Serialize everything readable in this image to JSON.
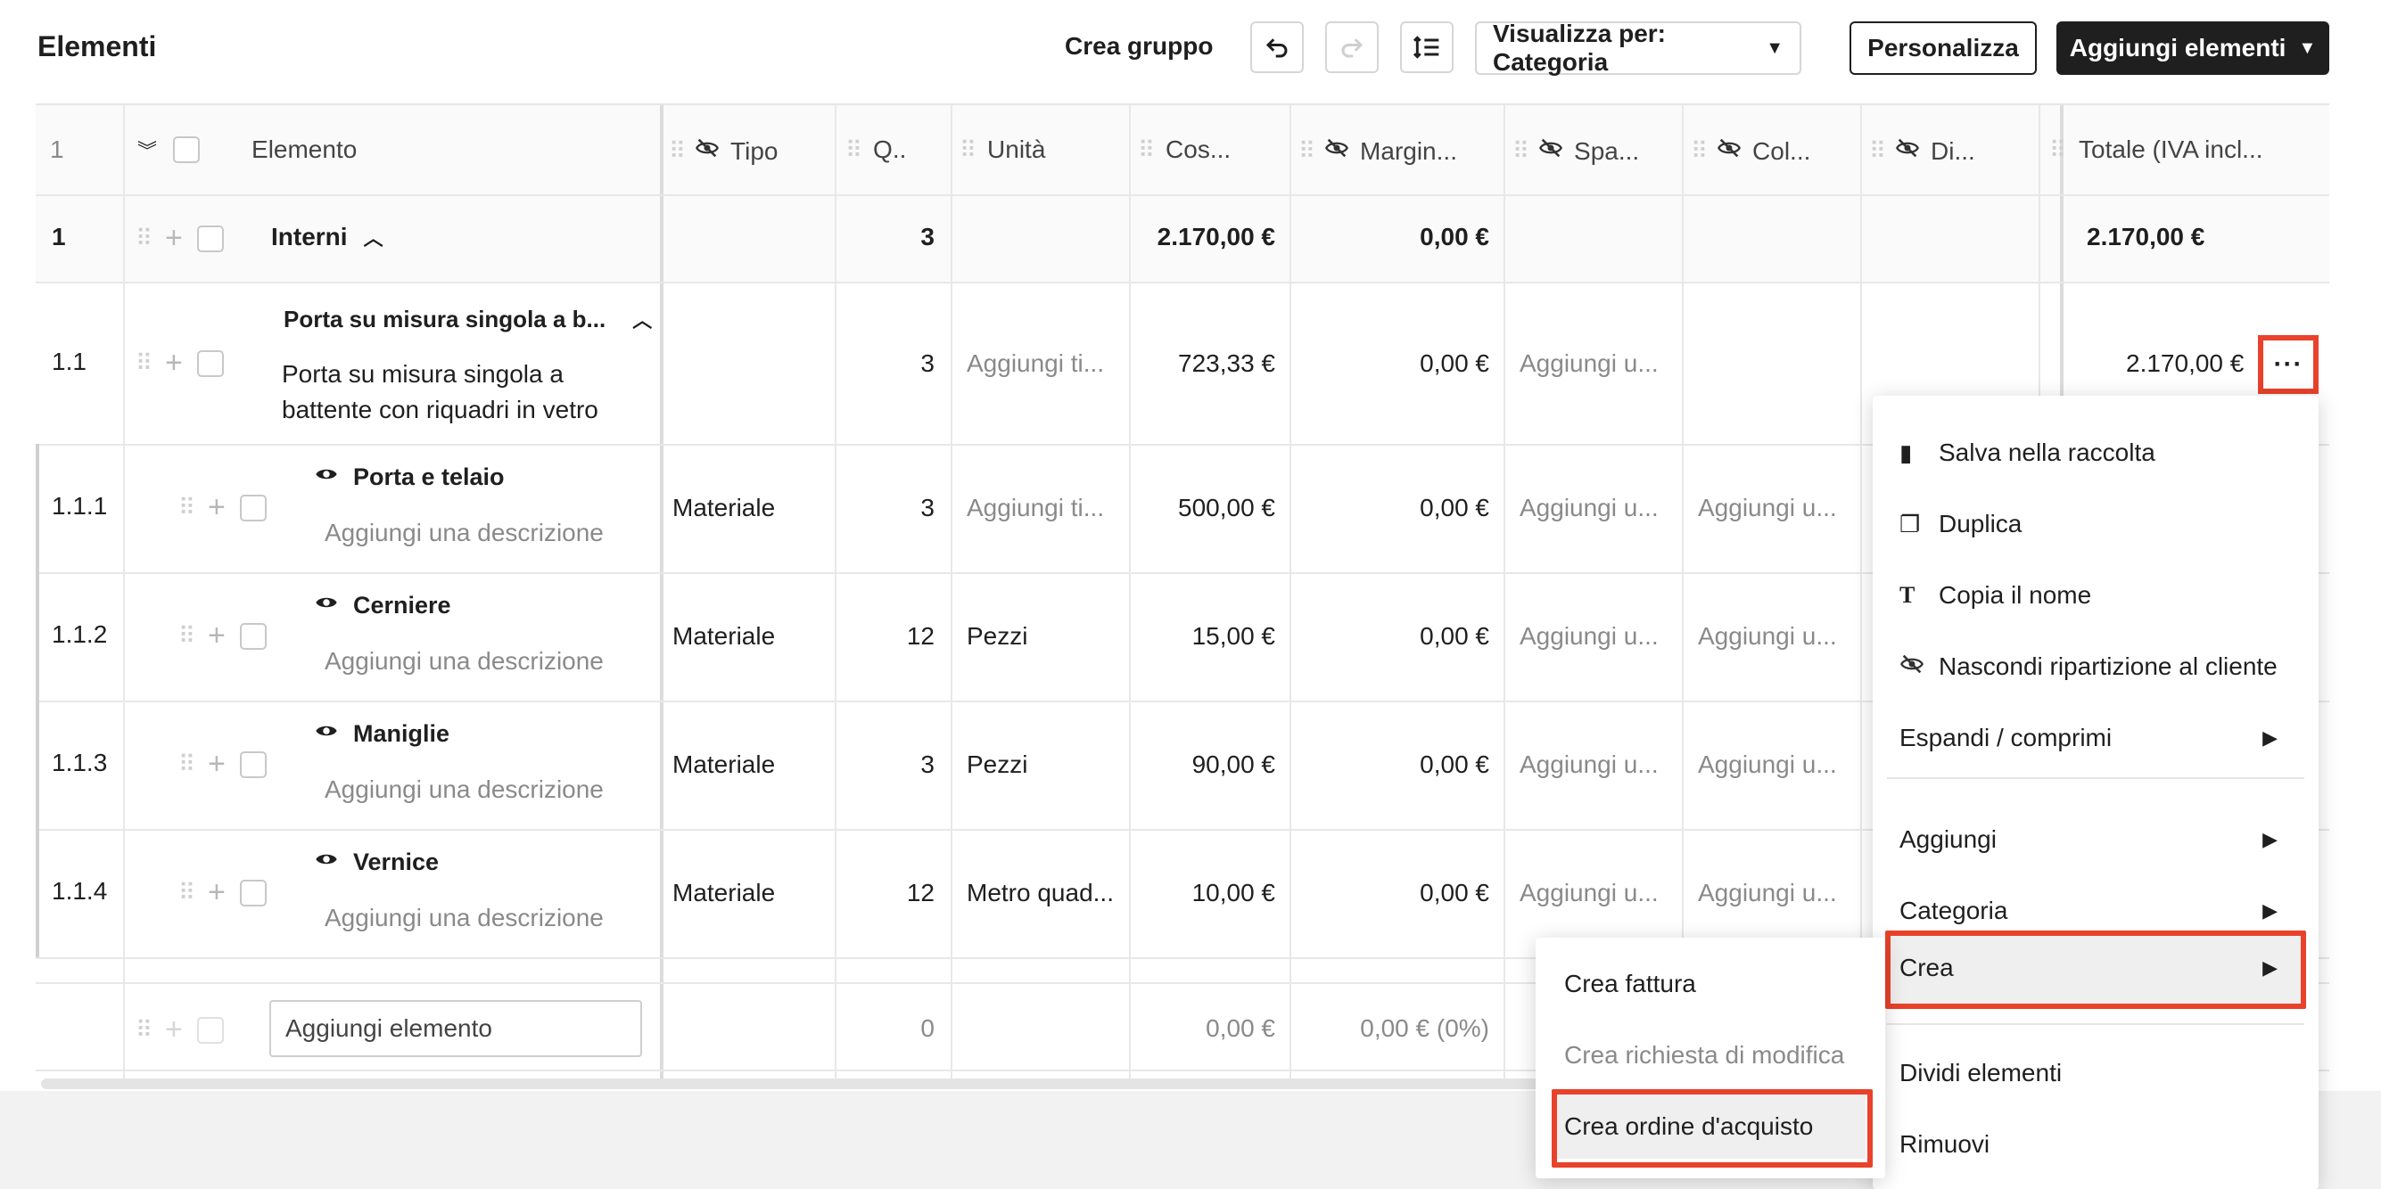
{
  "header": {
    "title": "Elementi",
    "create_group": "Crea gruppo",
    "view_by": "Visualizza per: Categoria",
    "customize": "Personalizza",
    "add_elements": "Aggiungi elementi"
  },
  "columns": {
    "index": "1",
    "element": "Elemento",
    "type": "Tipo",
    "qty": "Q..",
    "unit": "Unità",
    "cost": "Cos...",
    "margin": "Margin...",
    "spa": "Spa...",
    "col": "Col...",
    "di": "Di...",
    "total": "Totale (IVA incl..."
  },
  "group": {
    "index": "1",
    "name": "Interni",
    "qty": "3",
    "cost": "2.170,00 €",
    "margin": "0,00 €",
    "total": "2.170,00 €"
  },
  "item": {
    "index": "1.1",
    "title": "Porta su misura singola a b...",
    "desc_line1": "Porta su misura singola a",
    "desc_line2": "battente con riquadri in vetro",
    "qty": "3",
    "unit": "Aggiungi ti...",
    "cost": "723,33 €",
    "margin": "0,00 €",
    "spa": "Aggiungi u...",
    "total": "2.170,00 €"
  },
  "subitems": [
    {
      "index": "1.1.1",
      "name": "Porta e telaio",
      "desc": "Aggiungi una descrizione",
      "type": "Materiale",
      "qty": "3",
      "unit": "Aggiungi ti...",
      "cost": "500,00 €",
      "margin": "0,00 €",
      "spa": "Aggiungi u...",
      "col": "Aggiungi u..."
    },
    {
      "index": "1.1.2",
      "name": "Cerniere",
      "desc": "Aggiungi una descrizione",
      "type": "Materiale",
      "qty": "12",
      "unit": "Pezzi",
      "cost": "15,00 €",
      "margin": "0,00 €",
      "spa": "Aggiungi u...",
      "col": "Aggiungi u..."
    },
    {
      "index": "1.1.3",
      "name": "Maniglie",
      "desc": "Aggiungi una descrizione",
      "type": "Materiale",
      "qty": "3",
      "unit": "Pezzi",
      "cost": "90,00 €",
      "margin": "0,00 €",
      "spa": "Aggiungi u...",
      "col": "Aggiungi u..."
    },
    {
      "index": "1.1.4",
      "name": "Vernice",
      "desc": "Aggiungi una descrizione",
      "type": "Materiale",
      "qty": "12",
      "unit": "Metro quad...",
      "cost": "10,00 €",
      "margin": "0,00 €",
      "spa": "Aggiungi u...",
      "col": "Aggiungi u..."
    }
  ],
  "add_row": {
    "placeholder": "Aggiungi elemento",
    "qty": "0",
    "cost": "0,00 €",
    "margin": "0,00 € (0%)"
  },
  "context_menu": {
    "save": "Salva nella raccolta",
    "duplicate": "Duplica",
    "copy_name": "Copia il nome",
    "hide_breakdown": "Nascondi ripartizione al cliente",
    "expand": "Espandi / comprimi",
    "add": "Aggiungi",
    "category": "Categoria",
    "create": "Crea",
    "split": "Dividi elementi",
    "remove": "Rimuovi"
  },
  "submenu": {
    "invoice": "Crea fattura",
    "change_request": "Crea richiesta di modifica",
    "purchase_order": "Crea ordine d'acquisto"
  },
  "colors": {
    "highlight": "#e8422b",
    "dark_button": "#1f1f1f"
  }
}
